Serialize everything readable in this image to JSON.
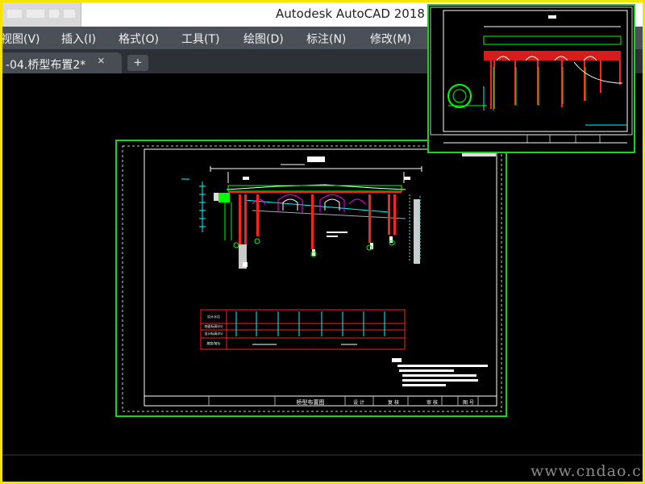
{
  "window": {
    "title": "Autodesk AutoCAD 2018"
  },
  "menubar": {
    "items": [
      {
        "label": "视图(V)"
      },
      {
        "label": "插入(I)"
      },
      {
        "label": "格式(O)"
      },
      {
        "label": "工具(T)"
      },
      {
        "label": "绘图(D)"
      },
      {
        "label": "标注(N)"
      },
      {
        "label": "修改(M)"
      }
    ]
  },
  "tabs": {
    "active_label": "-04.桥型布置2*",
    "close_glyph": "×",
    "new_tab_glyph": "+"
  },
  "drawing": {
    "title_block_name": "桥型布置图",
    "title_block_cells": [
      "设 计",
      "复 核",
      "审 核",
      "图 号"
    ],
    "table_rows": [
      "设计水位",
      "地面标高(m)",
      "设计标高(m)",
      "坡度/坡长"
    ]
  },
  "watermark": "www.cndao.com",
  "colors": {
    "frame_border": "#f4e400",
    "paper_border": "#1fd11f",
    "cad_green": "#00ff00",
    "cad_red": "#ff2020",
    "cad_cyan": "#00ffff",
    "cad_magenta": "#ff00ff",
    "cad_white": "#ffffff"
  }
}
